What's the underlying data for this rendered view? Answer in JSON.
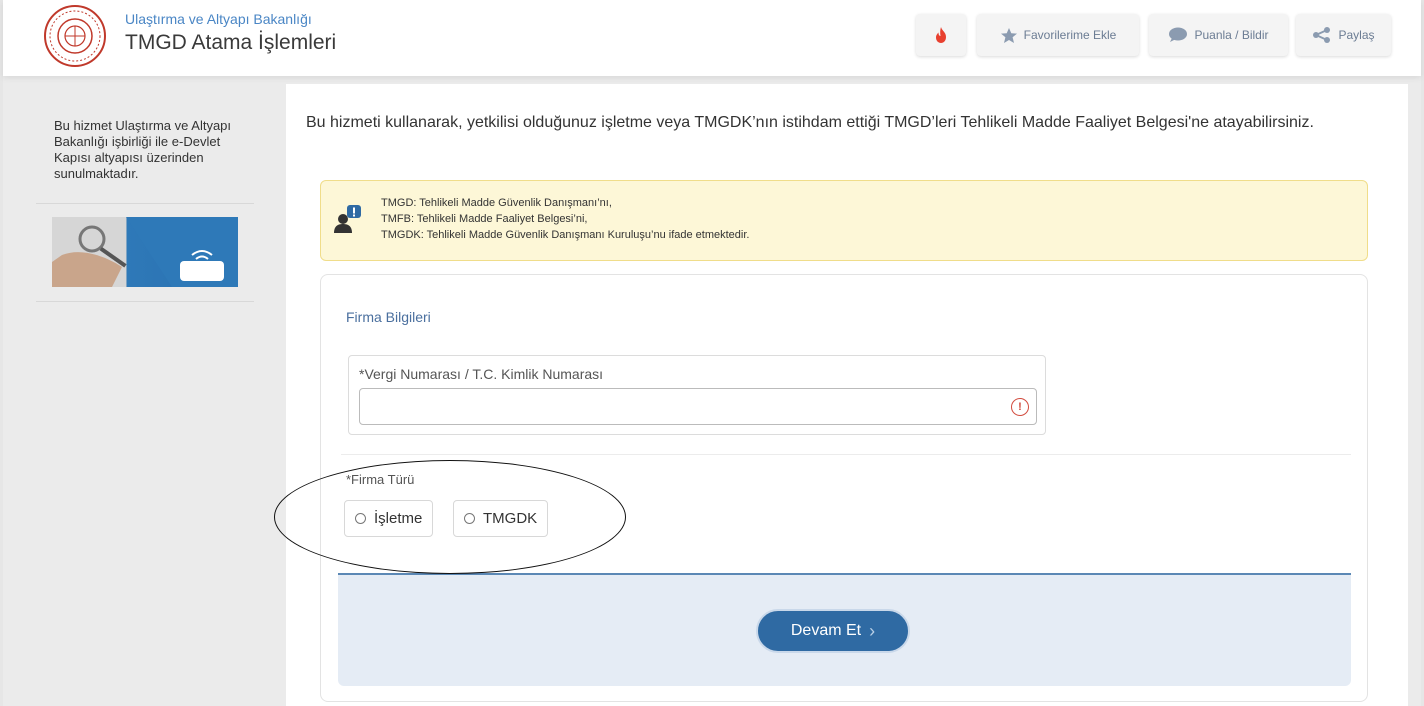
{
  "header": {
    "ministry": "Ulaştırma ve Altyapı Bakanlığı",
    "service_title": "TMGD Atama İşlemleri",
    "buttons": {
      "favorite": "Favorilerime Ekle",
      "rate": "Puanla / Bildir",
      "share": "Paylaş"
    }
  },
  "sidebar": {
    "text": "Bu hizmet Ulaştırma ve Altyapı Bakanlığı işbirliği ile e-Devlet Kapısı altyapısı üzerinden sunulmaktadır."
  },
  "main": {
    "intro": "Bu hizmeti kullanarak, yetkilisi olduğunuz işletme veya TMGDK’nın istihdam ettiği TMGD’leri Tehlikeli Madde Faaliyet Belgesi'ne atayabilirsiniz.",
    "info": {
      "line1": "TMGD: Tehlikeli Madde Güvenlik Danışmanı’nı,",
      "line2": "TMFB: Tehlikeli Madde Faaliyet Belgesi’ni,",
      "line3": "TMGDK: Tehlikeli Madde Güvenlik Danışmanı Kuruluşu’nu ifade etmektedir."
    },
    "form": {
      "section_title": "Firma Bilgileri",
      "tax_label": "*Vergi Numarası / T.C. Kimlik Numarası",
      "tax_value": "",
      "firm_type_label": "*Firma Türü",
      "options": [
        "İşletme",
        "TMGDK"
      ],
      "submit": "Devam Et"
    }
  },
  "colors": {
    "accent": "#2f6aa3",
    "link": "#4a86c5",
    "warning_bg": "#fdf7d7",
    "error": "#d24b3e"
  }
}
